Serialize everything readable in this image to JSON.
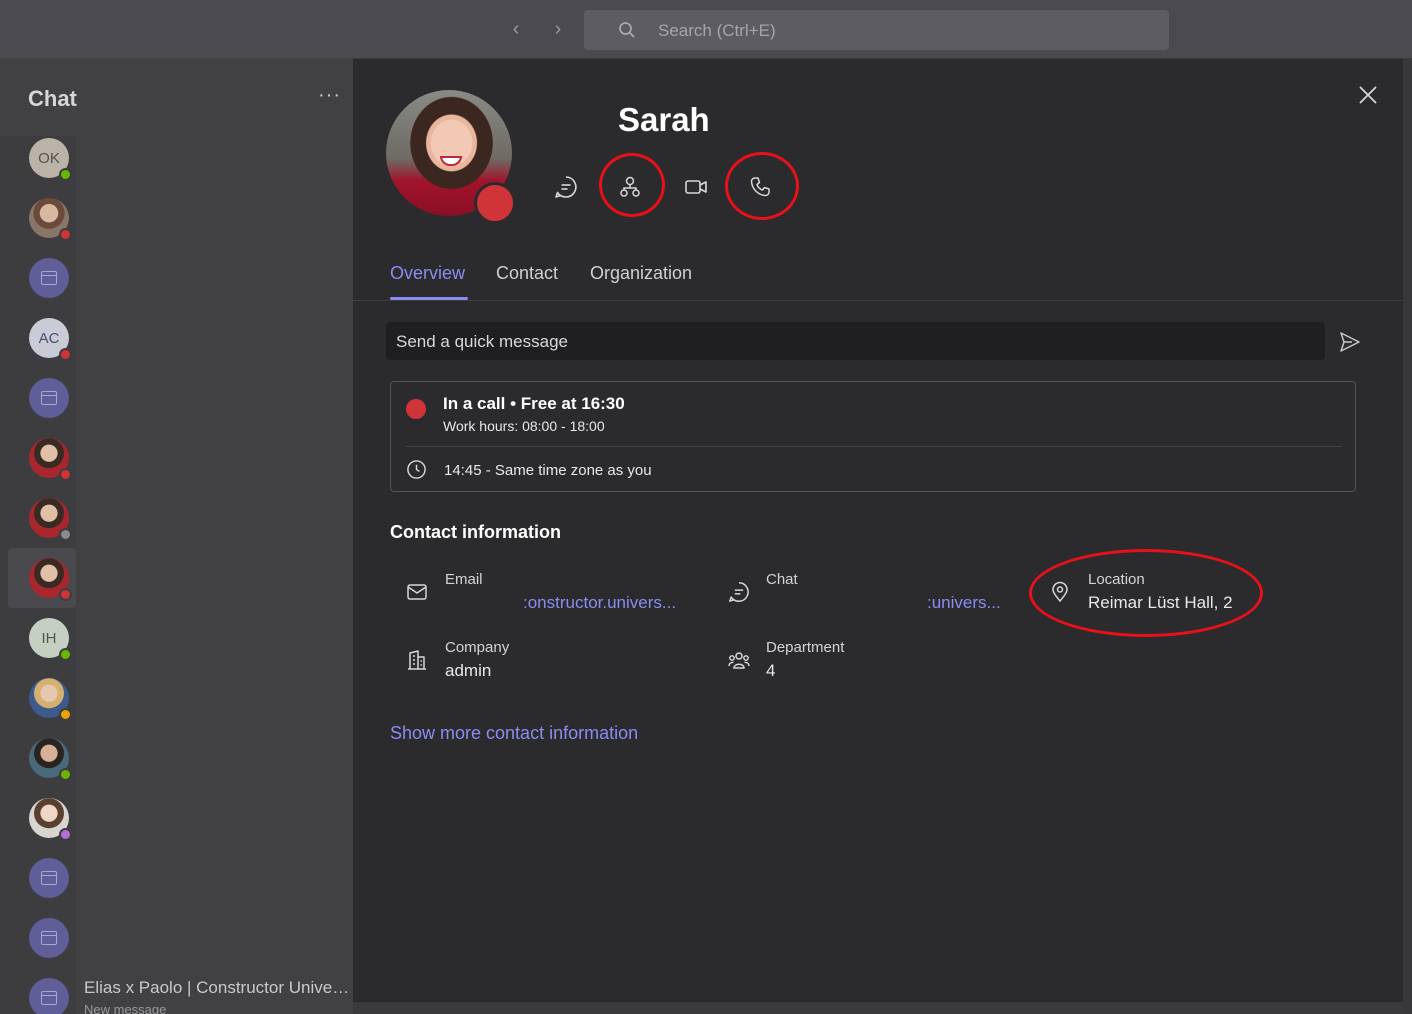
{
  "search": {
    "placeholder": "Search (Ctrl+E)"
  },
  "sidebar": {
    "title": "Chat",
    "more": "···",
    "avatars": [
      {
        "initials": "OK",
        "presence": "green"
      },
      {
        "initials": "",
        "presence": "red"
      },
      {
        "initials": "",
        "presence": ""
      },
      {
        "initials": "AC",
        "presence": "red"
      },
      {
        "initials": "",
        "presence": ""
      },
      {
        "initials": "",
        "presence": "red"
      },
      {
        "initials": "",
        "presence": "grey"
      },
      {
        "initials": "",
        "presence": "red"
      },
      {
        "initials": "IH",
        "presence": "green"
      },
      {
        "initials": "",
        "presence": "yellow"
      },
      {
        "initials": "",
        "presence": "green"
      },
      {
        "initials": "",
        "presence": "purple"
      }
    ],
    "last_chat": {
      "title": "Elias x Paolo | Constructor Univers...",
      "subtitle": "New message"
    }
  },
  "profile": {
    "name": "Sarah",
    "presence_color": "#d13438",
    "tabs": [
      "Overview",
      "Contact",
      "Organization"
    ],
    "active_tab": "Overview",
    "quick_message_placeholder": "Send a quick message",
    "status": {
      "main": "In a call • Free at 16:30",
      "hours": "Work hours: 08:00 - 18:00",
      "timezone": "14:45 - Same time zone as you"
    },
    "contact_info": {
      "title": "Contact information",
      "email_label": "Email",
      "email_value": ":onstructor.univers...",
      "chat_label": "Chat",
      "chat_value": ":univers...",
      "location_label": "Location",
      "location_value": "Reimar Lüst Hall, 2",
      "company_label": "Company",
      "company_value": "admin",
      "department_label": "Department",
      "department_value": "4"
    },
    "show_more": "Show more contact information"
  },
  "colors": {
    "accent": "#8b8cf0",
    "annotation": "#e8101a",
    "busy": "#d13438"
  }
}
